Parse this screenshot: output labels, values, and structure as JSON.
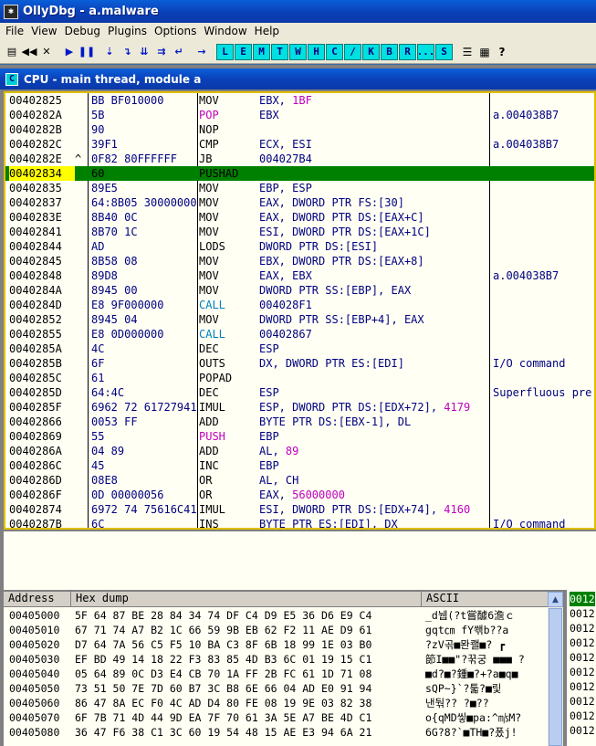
{
  "window": {
    "title": "OllyDbg - a.malware",
    "icon": "bug-icon"
  },
  "menu": [
    "File",
    "View",
    "Debug",
    "Plugins",
    "Options",
    "Window",
    "Help"
  ],
  "toolbar": {
    "controls": [
      {
        "name": "open-icon",
        "glyph": "▤"
      },
      {
        "name": "restart-icon",
        "glyph": "◀◀"
      },
      {
        "name": "close-icon",
        "glyph": "✕"
      },
      {
        "name": "run-icon",
        "glyph": "▶"
      },
      {
        "name": "pause-icon",
        "glyph": "❚❚"
      },
      {
        "name": "step-into-icon",
        "glyph": "⇣"
      },
      {
        "name": "step-over-icon",
        "glyph": "↴"
      },
      {
        "name": "trace-into-icon",
        "glyph": "⇊"
      },
      {
        "name": "trace-over-icon",
        "glyph": "⇉"
      },
      {
        "name": "execute-till-return-icon",
        "glyph": "↵"
      },
      {
        "name": "go-to-address-icon",
        "glyph": "→"
      }
    ],
    "letters": [
      "L",
      "E",
      "M",
      "T",
      "W",
      "H",
      "C",
      "/",
      "K",
      "B",
      "R",
      "...",
      "S"
    ],
    "right_controls": [
      {
        "name": "list-icon",
        "glyph": "☰"
      },
      {
        "name": "colors-icon",
        "glyph": "▦"
      },
      {
        "name": "help-icon",
        "glyph": "?"
      }
    ]
  },
  "cpu": {
    "caption": "CPU - main thread, module a",
    "caption_icon": "C",
    "selected_index": 5,
    "rows": [
      {
        "addr": "00402825",
        "jmp": "",
        "hex": "BB BF010000",
        "mn": "MOV",
        "op": "EBX, 1BF",
        "cm": ""
      },
      {
        "addr": "0040282A",
        "jmp": "",
        "hex": "5B",
        "mn": "POP",
        "op": "EBX",
        "cm": "a.004038B7"
      },
      {
        "addr": "0040282B",
        "jmp": "",
        "hex": "90",
        "mn": "NOP",
        "op": "",
        "cm": ""
      },
      {
        "addr": "0040282C",
        "jmp": "",
        "hex": "39F1",
        "mn": "CMP",
        "op": "ECX, ESI",
        "cm": "a.004038B7"
      },
      {
        "addr": "0040282E",
        "jmp": "^",
        "hex": "0F82 80FFFFFF",
        "mn": "JB",
        "op": "004027B4",
        "cm": ""
      },
      {
        "addr": "00402834",
        "jmp": "",
        "hex": "60",
        "mn": "PUSHAD",
        "op": "",
        "cm": ""
      },
      {
        "addr": "00402835",
        "jmp": "",
        "hex": "89E5",
        "mn": "MOV",
        "op": "EBP, ESP",
        "cm": ""
      },
      {
        "addr": "00402837",
        "jmp": "",
        "hex": "64:8B05 30000000",
        "mn": "MOV",
        "op": "EAX, DWORD PTR FS:[30]",
        "cm": ""
      },
      {
        "addr": "0040283E",
        "jmp": "",
        "hex": "8B40 0C",
        "mn": "MOV",
        "op": "EAX, DWORD PTR DS:[EAX+C]",
        "cm": ""
      },
      {
        "addr": "00402841",
        "jmp": "",
        "hex": "8B70 1C",
        "mn": "MOV",
        "op": "ESI, DWORD PTR DS:[EAX+1C]",
        "cm": ""
      },
      {
        "addr": "00402844",
        "jmp": "",
        "hex": "AD",
        "mn": "LODS",
        "op": "DWORD PTR DS:[ESI]",
        "cm": ""
      },
      {
        "addr": "00402845",
        "jmp": "",
        "hex": "8B58 08",
        "mn": "MOV",
        "op": "EBX, DWORD PTR DS:[EAX+8]",
        "cm": ""
      },
      {
        "addr": "00402848",
        "jmp": "",
        "hex": "89D8",
        "mn": "MOV",
        "op": "EAX, EBX",
        "cm": "a.004038B7"
      },
      {
        "addr": "0040284A",
        "jmp": "",
        "hex": "8945 00",
        "mn": "MOV",
        "op": "DWORD PTR SS:[EBP], EAX",
        "cm": ""
      },
      {
        "addr": "0040284D",
        "jmp": "",
        "hex": "E8 9F000000",
        "mn": "CALL",
        "op": "004028F1",
        "cm": ""
      },
      {
        "addr": "00402852",
        "jmp": "",
        "hex": "8945 04",
        "mn": "MOV",
        "op": "DWORD PTR SS:[EBP+4], EAX",
        "cm": ""
      },
      {
        "addr": "00402855",
        "jmp": "",
        "hex": "E8 0D000000",
        "mn": "CALL",
        "op": "00402867",
        "cm": ""
      },
      {
        "addr": "0040285A",
        "jmp": "",
        "hex": "4C",
        "mn": "DEC",
        "op": "ESP",
        "cm": ""
      },
      {
        "addr": "0040285B",
        "jmp": "",
        "hex": "6F",
        "mn": "OUTS",
        "op": "DX, DWORD PTR ES:[EDI]",
        "cm": "I/O command"
      },
      {
        "addr": "0040285C",
        "jmp": "",
        "hex": "61",
        "mn": "POPAD",
        "op": "",
        "cm": ""
      },
      {
        "addr": "0040285D",
        "jmp": "",
        "hex": "64:4C",
        "mn": "DEC",
        "op": "ESP",
        "cm": "Superfluous pre"
      },
      {
        "addr": "0040285F",
        "jmp": "",
        "hex": "6962 72 61727941",
        "mn": "IMUL",
        "op": "ESP, DWORD PTR DS:[EDX+72], 4179",
        "cm": ""
      },
      {
        "addr": "00402866",
        "jmp": "",
        "hex": "0053 FF",
        "mn": "ADD",
        "op": "BYTE PTR DS:[EBX-1], DL",
        "cm": ""
      },
      {
        "addr": "00402869",
        "jmp": "",
        "hex": "55",
        "mn": "PUSH",
        "op": "EBP",
        "cm": ""
      },
      {
        "addr": "0040286A",
        "jmp": "",
        "hex": "04 89",
        "mn": "ADD",
        "op": "AL, 89",
        "cm": ""
      },
      {
        "addr": "0040286C",
        "jmp": "",
        "hex": "45",
        "mn": "INC",
        "op": "EBP",
        "cm": ""
      },
      {
        "addr": "0040286D",
        "jmp": "",
        "hex": "08E8",
        "mn": "OR",
        "op": "AL, CH",
        "cm": ""
      },
      {
        "addr": "0040286F",
        "jmp": "",
        "hex": "0D 00000056",
        "mn": "OR",
        "op": "EAX, 56000000",
        "cm": ""
      },
      {
        "addr": "00402874",
        "jmp": "",
        "hex": "6972 74 75616C41",
        "mn": "IMUL",
        "op": "ESI, DWORD PTR DS:[EDX+74], 4160",
        "cm": ""
      },
      {
        "addr": "0040287B",
        "jmp": "",
        "hex": "6C",
        "mn": "INS",
        "op": "BYTE PTR ES:[EDI], DX",
        "cm": "I/O command"
      }
    ]
  },
  "colors": {
    "mn_default": "#000000",
    "mn_pop": "#c000c0",
    "mn_push": "#c000c0",
    "mn_call": "#0080c0",
    "imm": "#c000c0",
    "comment": "#000080"
  },
  "dump": {
    "headers": {
      "address": "Address",
      "hex": "Hex dump",
      "ascii": "ASCII"
    },
    "rows": [
      {
        "addr": "00405000",
        "hex": "5F 64 87 BE 28 84 34 74 DF C4 D9 E5 36 D6 E9 C4",
        "ascii": "_d뉍(?t嘗醵6澹ｃ"
      },
      {
        "addr": "00405010",
        "hex": "67 71 74 A7 B2 1C 66 59 9B EB 62 F2 11 AE D9 61",
        "ascii": "gqt㎝ fY쐒b??a"
      },
      {
        "addr": "00405020",
        "dhex": "",
        "hex": "D7 64 7A 56 C5 F5 10 BA C3 8F 6B 18 99 1E 03 B0",
        "ascii": "?zV곢■뫈쾔■? ┏"
      },
      {
        "addr": "00405030",
        "hex": "EF BD 49 14 18 22 F3 83 85 4D B3 6C 01 19 15 C1",
        "ascii": "節I■■\"?꾺궁 ■■■ ?"
      },
      {
        "addr": "00405040",
        "hex": "05 64 89 0C D3 E4 CB 70 1A FF 2B FC 61 1D 71 08",
        "ascii": "■d?■?鍾■?+?a■q■"
      },
      {
        "addr": "00405050",
        "hex": "73 51 50 7E 7D 60 B7 3C B8 6E 66 04 AD E0 91 94",
        "ascii": "sQP~}`?툷?■맃"
      },
      {
        "addr": "00405060",
        "hex": "86 47 8A EC F0 4C AD D4 80 FE 08 19 9E 03 82 38",
        "ascii": "낸둮??  ?■??"
      },
      {
        "addr": "00405070",
        "hex": "6F 7B 71 4D 44 9D EA 7F 70 61 3A 5E A7 BE 4D C1",
        "ascii": "o{qMD앃■pa:^㎧M?"
      },
      {
        "addr": "00405080",
        "hex": "36 47 F6 38 C1 3C 60 19 54 48 15 AE E3 94 6A 21",
        "ascii": "6G?8?`■TH■?퐀j!"
      }
    ]
  },
  "stack": {
    "rows": [
      "0012",
      "0012",
      "0012",
      "0012",
      "0012",
      "0012",
      "0012",
      "0012",
      "0012",
      "0012"
    ]
  }
}
